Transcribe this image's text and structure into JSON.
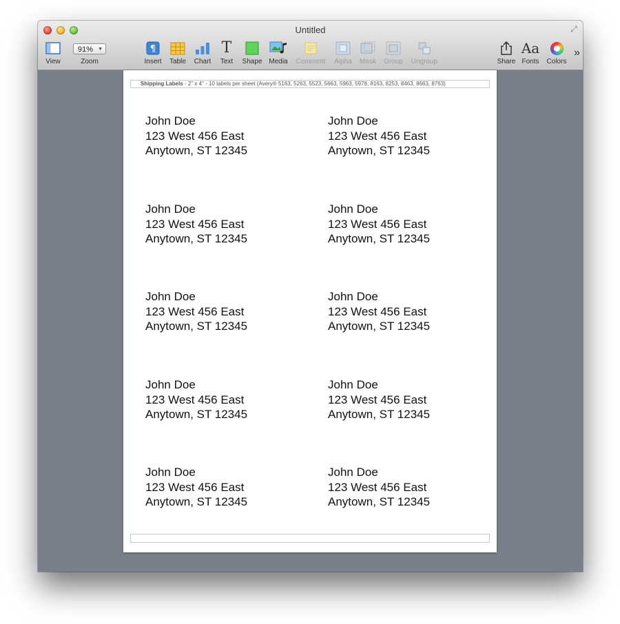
{
  "window": {
    "title": "Untitled"
  },
  "toolbar": {
    "view_label": "View",
    "zoom_label": "Zoom",
    "zoom_value": "91%",
    "insert_label": "Insert",
    "table_label": "Table",
    "chart_label": "Chart",
    "text_label": "Text",
    "shape_label": "Shape",
    "media_label": "Media",
    "comment_label": "Comment",
    "alpha_label": "Alpha",
    "mask_label": "Mask",
    "group_label": "Group",
    "ungroup_label": "Ungroup",
    "share_label": "Share",
    "fonts_label": "Fonts",
    "fonts_icon_text": "Aa",
    "colors_label": "Colors",
    "text_icon_text": "T",
    "more_text": "»"
  },
  "document": {
    "header_bold": "Shipping Labels",
    "header_rest": " - 2\" x 4\" - 10 labels per sheet (Avery® 5163, 5263, 5523, 5663, 5963, 5978, 8163, 8253, 8463, 8663, 8763)",
    "labels": [
      {
        "name": "John Doe",
        "street": "123 West 456 East",
        "city": "Anytown, ST 12345"
      },
      {
        "name": "John Doe",
        "street": "123 West 456 East",
        "city": "Anytown, ST 12345"
      },
      {
        "name": "John Doe",
        "street": "123 West 456 East",
        "city": "Anytown, ST 12345"
      },
      {
        "name": "John Doe",
        "street": "123 West 456 East",
        "city": "Anytown, ST 12345"
      },
      {
        "name": "John Doe",
        "street": "123 West 456 East",
        "city": "Anytown, ST 12345"
      },
      {
        "name": "John Doe",
        "street": "123 West 456 East",
        "city": "Anytown, ST 12345"
      },
      {
        "name": "John Doe",
        "street": "123 West 456 East",
        "city": "Anytown, ST 12345"
      },
      {
        "name": "John Doe",
        "street": "123 West 456 East",
        "city": "Anytown, ST 12345"
      },
      {
        "name": "John Doe",
        "street": "123 West 456 East",
        "city": "Anytown, ST 12345"
      },
      {
        "name": "John Doe",
        "street": "123 West 456 East",
        "city": "Anytown, ST 12345"
      }
    ]
  },
  "colors": {
    "canvas_background": "#798089",
    "page": "#ffffff",
    "close_button": "#e2463a",
    "minimize_button": "#f0b32c",
    "maximize_button": "#63c33a"
  },
  "icons": [
    "view-icon",
    "insert-icon",
    "table-icon",
    "chart-icon",
    "text-icon",
    "shape-icon",
    "media-icon",
    "comment-icon",
    "alpha-icon",
    "mask-icon",
    "group-icon",
    "ungroup-icon",
    "share-icon",
    "fonts-icon",
    "colors-icon",
    "fullscreen-icon"
  ]
}
